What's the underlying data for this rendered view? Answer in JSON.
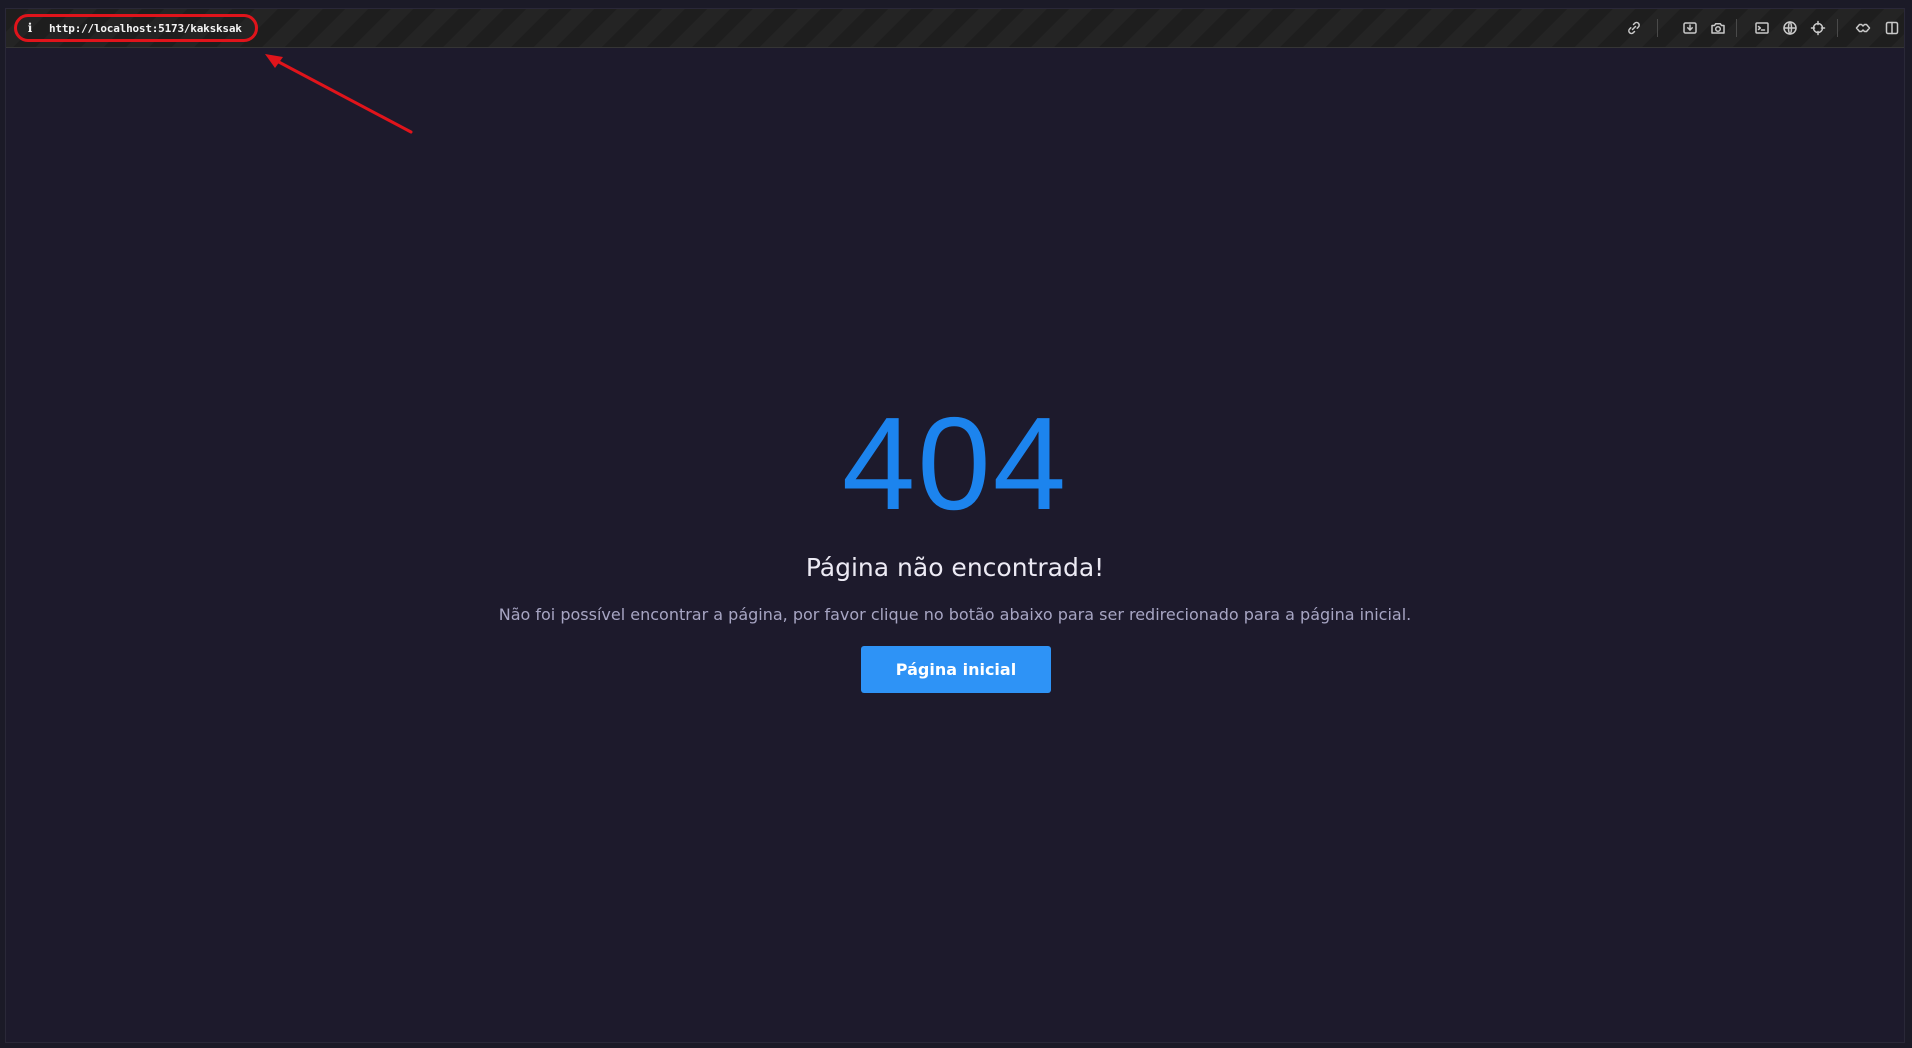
{
  "browser": {
    "url": "http://localhost:5173/kaksksak",
    "info_glyph": "i",
    "toolbar_icons": [
      "link-icon",
      "download-icon",
      "camera-icon",
      "terminal-icon",
      "globe-icon",
      "crosshair-icon",
      "extension-icon",
      "split-view-icon"
    ]
  },
  "annotation": {
    "highlight_color": "#e0141b",
    "arrow_color": "#e0141b"
  },
  "page": {
    "error_code": "404",
    "title": "Página não encontrada!",
    "description": "Não foi possível encontrar a página, por favor clique no botão abaixo para ser redirecionado para a página inicial.",
    "home_button_label": "Página inicial"
  },
  "colors": {
    "background": "#1d1a2c",
    "accent": "#1c84ee",
    "button": "#2e93f6",
    "title_text": "#eceaf4",
    "muted_text": "#a7a5c3"
  }
}
